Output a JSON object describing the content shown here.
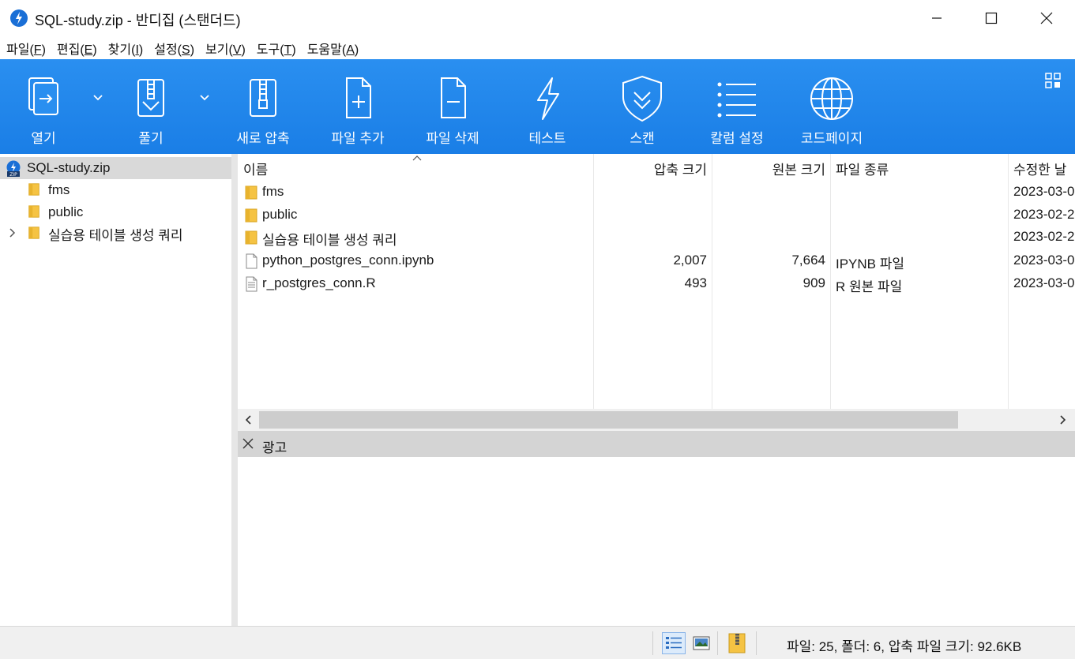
{
  "window": {
    "title": "SQL-study.zip - 반디집 (스탠더드)"
  },
  "menu": [
    {
      "label": "파일(",
      "key": "F",
      "end": ")"
    },
    {
      "label": "편집(",
      "key": "E",
      "end": ")"
    },
    {
      "label": "찾기(",
      "key": "I",
      "end": ")"
    },
    {
      "label": "설정(",
      "key": "S",
      "end": ")"
    },
    {
      "label": "보기(",
      "key": "V",
      "end": ")"
    },
    {
      "label": "도구(",
      "key": "T",
      "end": ")"
    },
    {
      "label": "도움말(",
      "key": "A",
      "end": ")"
    }
  ],
  "toolbar": {
    "open": "열기",
    "extract": "풀기",
    "new_archive": "새로 압축",
    "add_files": "파일 추가",
    "delete_files": "파일 삭제",
    "test": "테스트",
    "scan": "스캔",
    "columns": "칼럼 설정",
    "codepage": "코드페이지"
  },
  "tree": {
    "root": "SQL-study.zip",
    "items": [
      "fms",
      "public",
      "실습용 테이블 생성 쿼리"
    ]
  },
  "filelist": {
    "columns": {
      "name": "이름",
      "packed": "압축 크기",
      "original": "원본 크기",
      "type": "파일 종류",
      "modified": "수정한 날"
    },
    "rows": [
      {
        "name": "fms",
        "packed": "",
        "original": "",
        "type": "",
        "modified": "2023-03-0",
        "kind": "folder"
      },
      {
        "name": "public",
        "packed": "",
        "original": "",
        "type": "",
        "modified": "2023-02-2",
        "kind": "folder"
      },
      {
        "name": "실습용 테이블 생성 쿼리",
        "packed": "",
        "original": "",
        "type": "",
        "modified": "2023-02-2",
        "kind": "folder"
      },
      {
        "name": "python_postgres_conn.ipynb",
        "packed": "2,007",
        "original": "7,664",
        "type": "IPYNB 파일",
        "modified": "2023-03-0",
        "kind": "file"
      },
      {
        "name": "r_postgres_conn.R",
        "packed": "493",
        "original": "909",
        "type": "R 원본 파일",
        "modified": "2023-03-0",
        "kind": "textfile"
      }
    ]
  },
  "ad": {
    "label": "광고"
  },
  "status": {
    "text": "파일: 25, 폴더: 6, 압축 파일 크기: 92.6KB"
  },
  "colors": {
    "ribbon": "#1f86ec",
    "selection": "#d9d9d9",
    "folder": "#f5c343"
  }
}
